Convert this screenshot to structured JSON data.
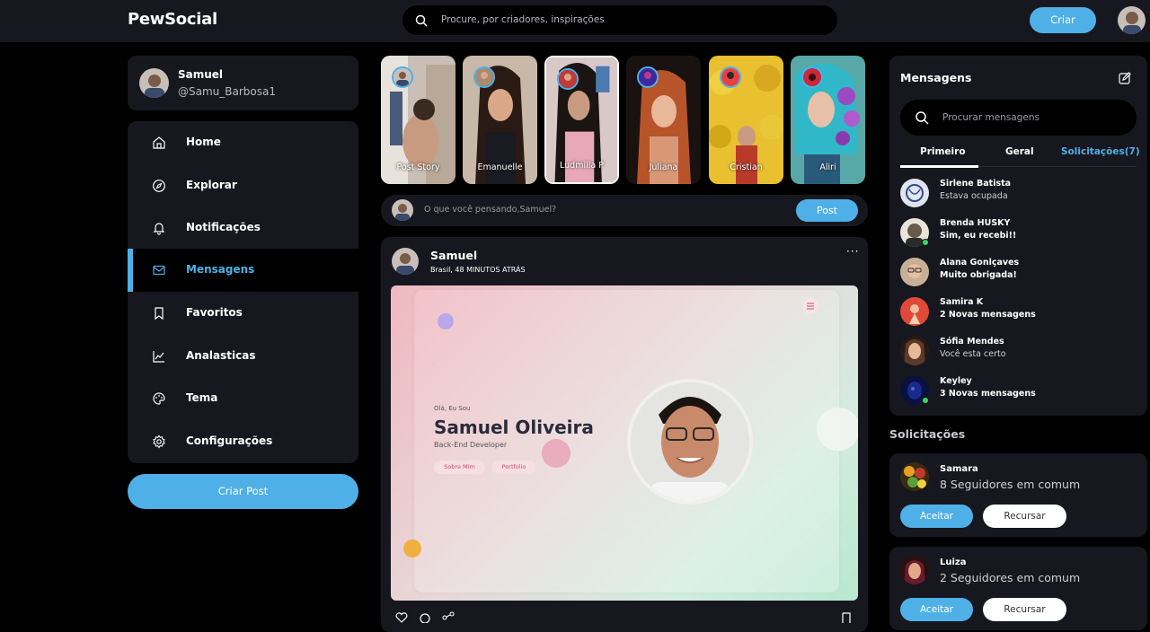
{
  "header": {
    "logo": "PewSocial",
    "search_placeholder": "Procure, por criadores, inspirações",
    "create_label": "Criar"
  },
  "profile": {
    "name": "Samuel",
    "handle": "@Samu_Barbosa1"
  },
  "sidebar": {
    "items": [
      {
        "label": "Home",
        "icon": "home-icon"
      },
      {
        "label": "Explorar",
        "icon": "compass-icon"
      },
      {
        "label": "Notificações",
        "icon": "bell-icon"
      },
      {
        "label": "Mensagens",
        "icon": "mail-icon",
        "active": true
      },
      {
        "label": "Favoritos",
        "icon": "bookmark-icon"
      },
      {
        "label": "Analasticas",
        "icon": "chart-icon"
      },
      {
        "label": "Tema",
        "icon": "palette-icon"
      },
      {
        "label": "Configurações",
        "icon": "gear-icon"
      }
    ],
    "create_post_label": "Criar Post"
  },
  "stories": [
    {
      "label": "Post Story"
    },
    {
      "label": "Emanuelle"
    },
    {
      "label": "Ludmilla P"
    },
    {
      "label": "Juliana"
    },
    {
      "label": "Cristian"
    },
    {
      "label": "Aliri"
    }
  ],
  "composer": {
    "placeholder": "O que você pensando,Samuel?",
    "post_label": "Post"
  },
  "feed": {
    "author": "Samuel",
    "meta": "Brasil, 48 MINUTOS ATRÁS",
    "more": "···",
    "image": {
      "hello": "Olá, Eu Sou",
      "name": "Samuel Oliveira",
      "role": "Back-End Developer",
      "button1": "Sobre Mim",
      "button2": "Portfolio"
    }
  },
  "messages": {
    "title": "Mensagens",
    "search_placeholder": "Procurar mensagens",
    "tabs": [
      "Primeiro",
      "Geral",
      "Solicitações(7)"
    ],
    "items": [
      {
        "name": "Sirlene Batista",
        "text": "Estava ocupada",
        "bold": false,
        "online": false,
        "color": "#dfe6f0"
      },
      {
        "name": "Brenda HUSKY",
        "text": "Sim, eu recebi!!",
        "bold": true,
        "online": true,
        "color": "#6a5a4a"
      },
      {
        "name": "Alana Gonlçaves",
        "text": "Muito obrigada!",
        "bold": true,
        "online": false,
        "color": "#a88a70"
      },
      {
        "name": "Samira K",
        "text": "2 Novas mensagens",
        "bold": true,
        "online": false,
        "color": "#e04838"
      },
      {
        "name": "Sófia Mendes",
        "text": "Você esta certo",
        "bold": false,
        "online": false,
        "color": "#5a3a2a"
      },
      {
        "name": "Keyley",
        "text": "3 Novas mensagens",
        "bold": true,
        "online": true,
        "color": "#1a2a6a"
      }
    ]
  },
  "requests": {
    "title": "Solicitações",
    "items": [
      {
        "name": "Samara",
        "mutual": "8 Seguidores em comum",
        "accept": "Aceitar",
        "reject": "Recursar"
      },
      {
        "name": "Luiza",
        "mutual": "2 Seguidores em comum",
        "accept": "Aceitar",
        "reject": "Recursar"
      }
    ]
  },
  "colors": {
    "accent": "#4fb0e8",
    "panel": "#17171f",
    "background": "#000000"
  }
}
